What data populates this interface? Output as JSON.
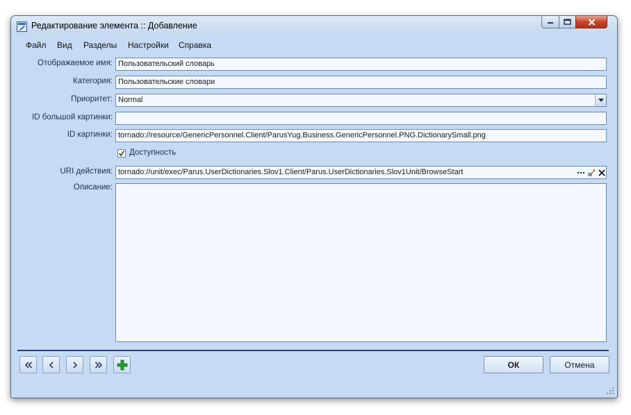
{
  "window": {
    "title": "Редактирование элемента :: Добавление"
  },
  "menu": [
    "Файл",
    "Вид",
    "Разделы",
    "Настройки",
    "Справка"
  ],
  "form": {
    "display_name": {
      "label": "Отображаемое имя:",
      "value": "Пользовательский словарь"
    },
    "category": {
      "label": "Категория:",
      "value": "Пользовательские словари"
    },
    "priority": {
      "label": "Приоритет:",
      "value": "Normal"
    },
    "large_image_id": {
      "label": "ID большой картинки:",
      "value": ""
    },
    "image_id": {
      "label": "ID картинки:",
      "value": "tornado://resource/GenericPersonnel.Client/ParusYug.Business.GenericPersonnel.PNG.DictionarySmall.png"
    },
    "availability": {
      "label": "Доступность",
      "checked": true
    },
    "action_uri": {
      "label": "URI действия:",
      "value": "tornado://unit/exec/Parus.UserDictionaries.Slov1.Client/Parus.UserDictionaries.Slov1Unit/BrowseStart"
    },
    "description": {
      "label": "Описание:",
      "value": ""
    }
  },
  "buttons": {
    "ok": "ОК",
    "cancel": "Отмена"
  },
  "icons": {
    "first": "double-chevron-left-icon",
    "prev": "chevron-left-icon",
    "next": "chevron-right-icon",
    "last": "double-chevron-right-icon",
    "add": "plus-icon",
    "browse": "ellipsis-icon",
    "edit": "edit-icon",
    "clear": "clear-icon"
  },
  "colors": {
    "window_bg": "#c6dbf3",
    "separator": "#2a3f6e",
    "add_green": "#1e9e2e",
    "close_red": "#c7432c"
  }
}
